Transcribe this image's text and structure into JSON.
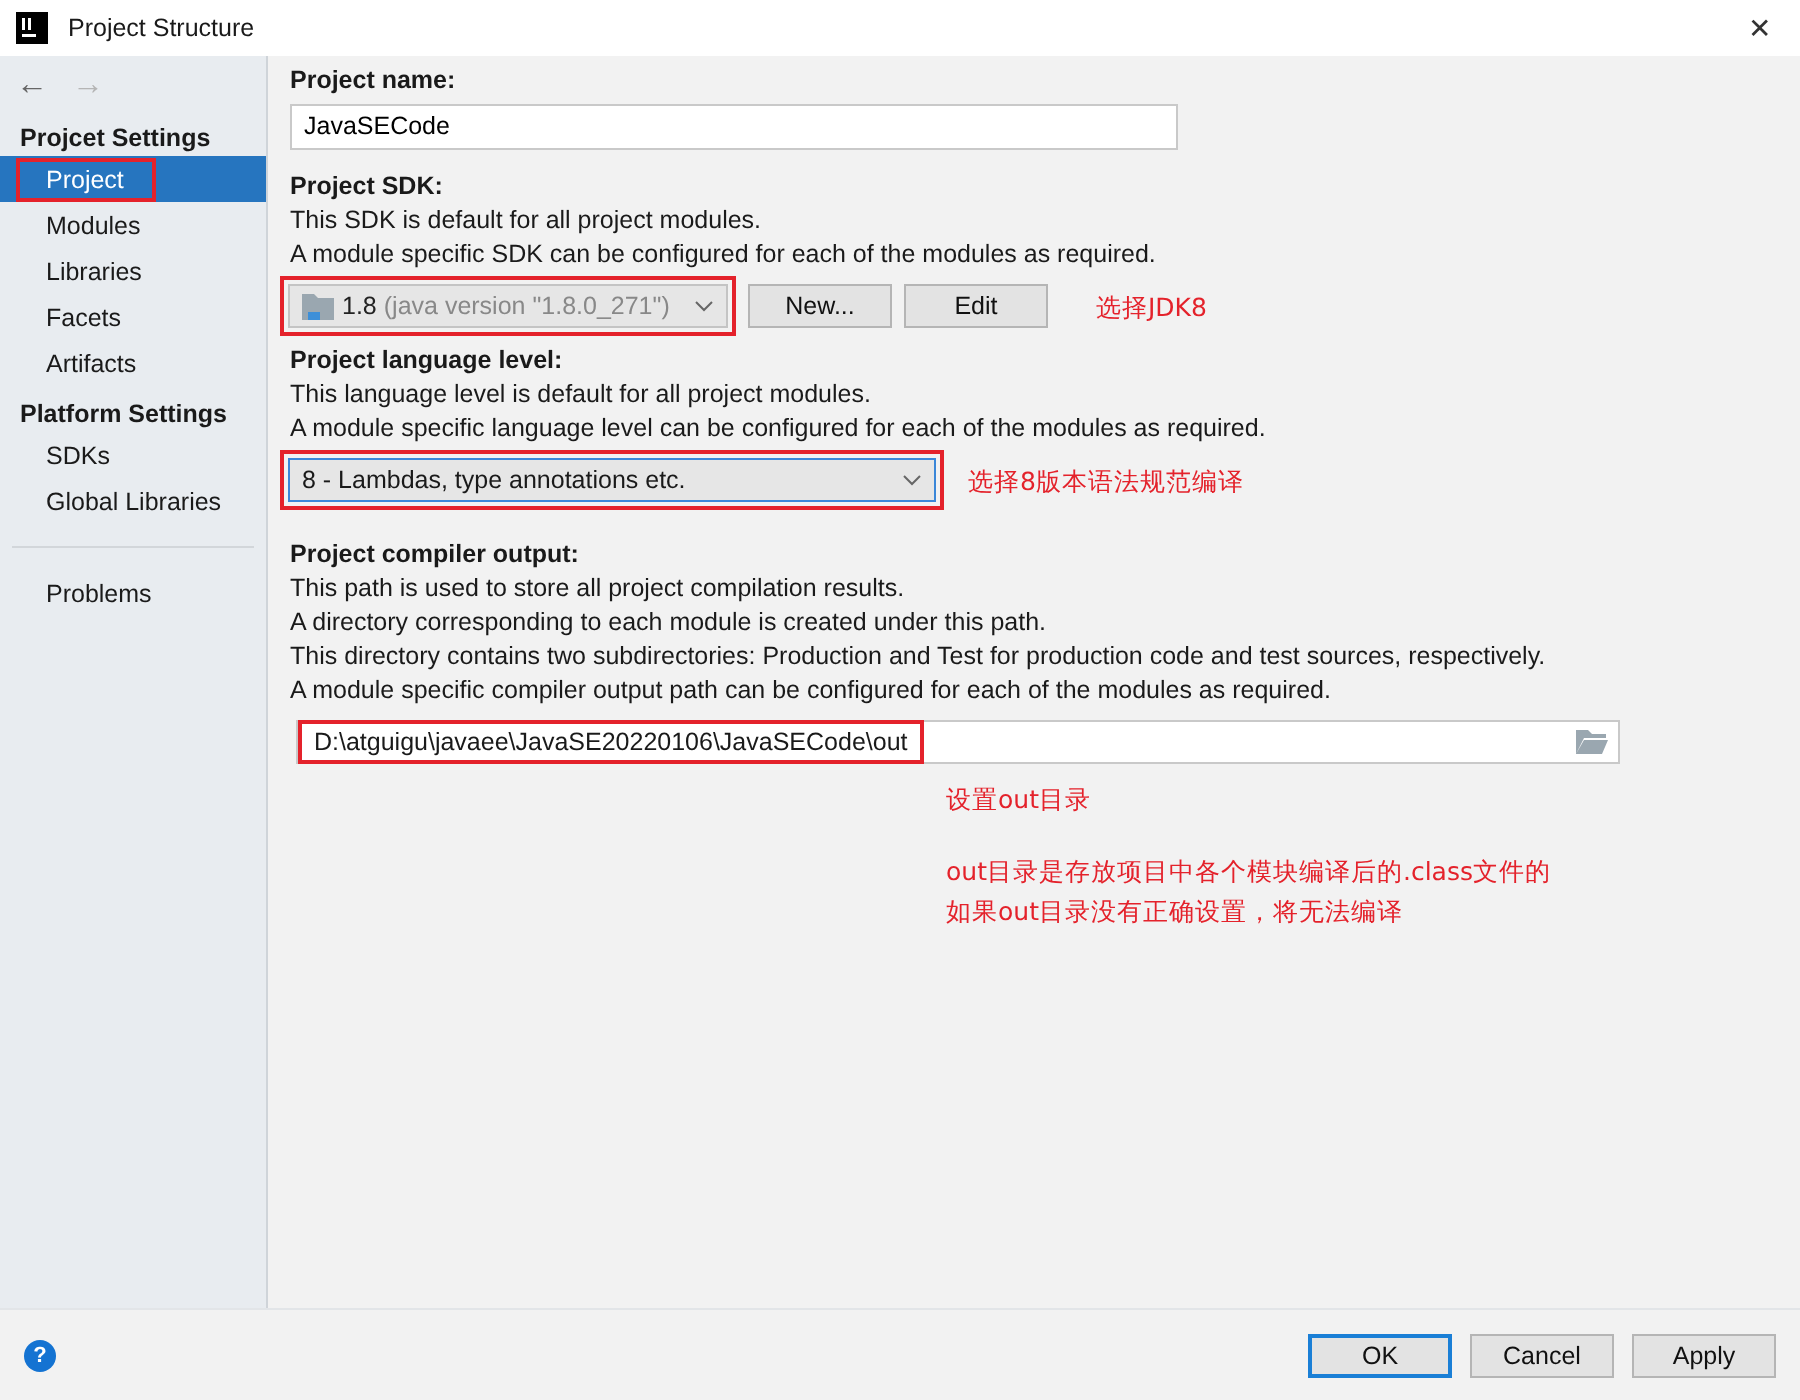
{
  "window": {
    "title": "Project Structure",
    "close": "✕"
  },
  "nav": {
    "back": "←",
    "forward": "→"
  },
  "sidebar": {
    "groups": [
      {
        "title": "Projcet Settings",
        "items": [
          {
            "label": "Project",
            "selected": true,
            "highlighted": true
          },
          {
            "label": "Modules",
            "selected": false,
            "highlighted": false
          },
          {
            "label": "Libraries",
            "selected": false,
            "highlighted": false
          },
          {
            "label": "Facets",
            "selected": false,
            "highlighted": false
          },
          {
            "label": "Artifacts",
            "selected": false,
            "highlighted": false
          }
        ]
      },
      {
        "title": "Platform Settings",
        "items": [
          {
            "label": "SDKs",
            "selected": false,
            "highlighted": false
          },
          {
            "label": "Global Libraries",
            "selected": false,
            "highlighted": false
          }
        ]
      }
    ],
    "bottom_items": [
      {
        "label": "Problems",
        "selected": false,
        "highlighted": false
      }
    ]
  },
  "project_name": {
    "label": "Project name:",
    "value": "JavaSECode"
  },
  "sdk": {
    "label": "Project SDK:",
    "lines": [
      "This SDK is default for all project modules.",
      "A module specific SDK can be configured for each of the modules as required."
    ],
    "version": "1.8",
    "detail": "(java version \"1.8.0_271\")",
    "highlighted": true,
    "buttons": [
      "New...",
      "Edit"
    ],
    "note": "选择JDK8"
  },
  "language_level": {
    "label": "Project language level:",
    "lines": [
      "This language level is default for all project modules.",
      "A module specific language level can be configured for each of the modules as required."
    ],
    "value": "8 - Lambdas, type annotations etc.",
    "highlighted": true,
    "note": "选择8版本语法规范编译"
  },
  "compiler_output": {
    "label": "Project compiler output:",
    "lines": [
      "This path is used to store all project compilation results.",
      "A directory corresponding to each module is created under this path.",
      "This directory contains two subdirectories: Production and Test for production code and test sources, respectively.",
      "A module specific compiler output path can be configured for each of the modules as required."
    ],
    "value": "D:\\atguigu\\javaee\\JavaSE20220106\\JavaSECode\\out",
    "highlighted": true,
    "notes": [
      "设置out目录",
      "out目录是存放项目中各个模块编译后的.class文件的",
      "如果out目录没有正确设置，将无法编译"
    ]
  },
  "footer": {
    "help": "?",
    "buttons": [
      {
        "label": "OK",
        "selected": true
      },
      {
        "label": "Cancel",
        "selected": false
      },
      {
        "label": "Apply",
        "selected": false
      }
    ]
  }
}
